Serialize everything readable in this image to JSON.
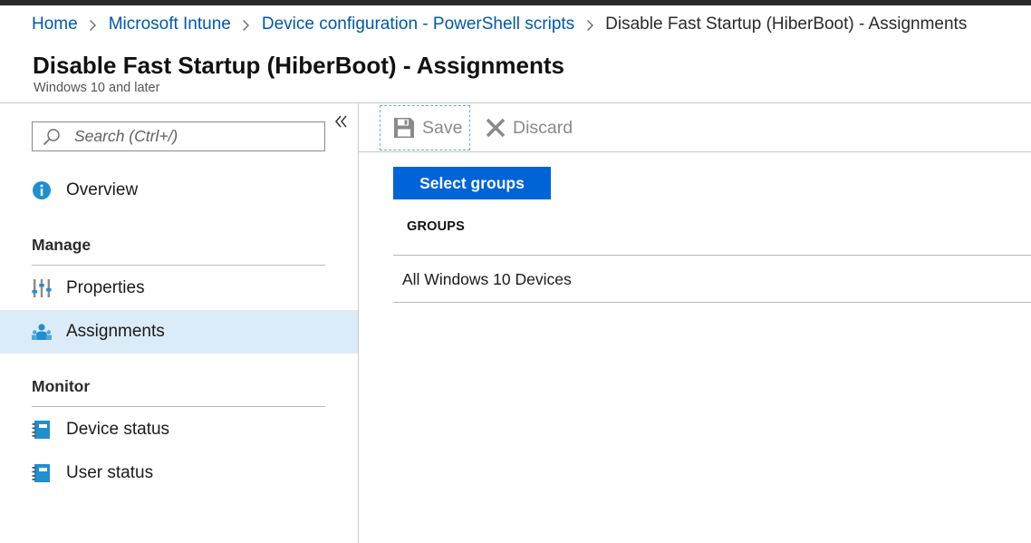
{
  "breadcrumb": {
    "items": [
      "Home",
      "Microsoft Intune",
      "Device configuration - PowerShell scripts"
    ],
    "current": "Disable Fast Startup (HiberBoot) - Assignments"
  },
  "header": {
    "title": "Disable Fast Startup (HiberBoot) - Assignments",
    "subtitle": "Windows 10 and later"
  },
  "sidebar": {
    "search": {
      "placeholder": "Search (Ctrl+/)",
      "value": ""
    },
    "overview": {
      "label": "Overview",
      "icon": "info-icon"
    },
    "sections": [
      {
        "title": "Manage",
        "items": [
          {
            "label": "Properties",
            "icon": "sliders-icon",
            "active": false
          },
          {
            "label": "Assignments",
            "icon": "assignments-icon",
            "active": true
          }
        ]
      },
      {
        "title": "Monitor",
        "items": [
          {
            "label": "Device status",
            "icon": "notebook-icon",
            "active": false
          },
          {
            "label": "User status",
            "icon": "notebook-icon",
            "active": false
          }
        ]
      }
    ]
  },
  "toolbar": {
    "save_label": "Save",
    "discard_label": "Discard"
  },
  "main": {
    "select_groups_label": "Select groups",
    "groups_header": "GROUPS",
    "groups": [
      "All Windows 10 Devices"
    ]
  },
  "colors": {
    "link": "#0058ad",
    "primary_button": "#0063d8",
    "active_nav_bg": "#dcebf8",
    "icon_blue": "#1f8fd0",
    "top_bar": "#2a2a2a"
  }
}
